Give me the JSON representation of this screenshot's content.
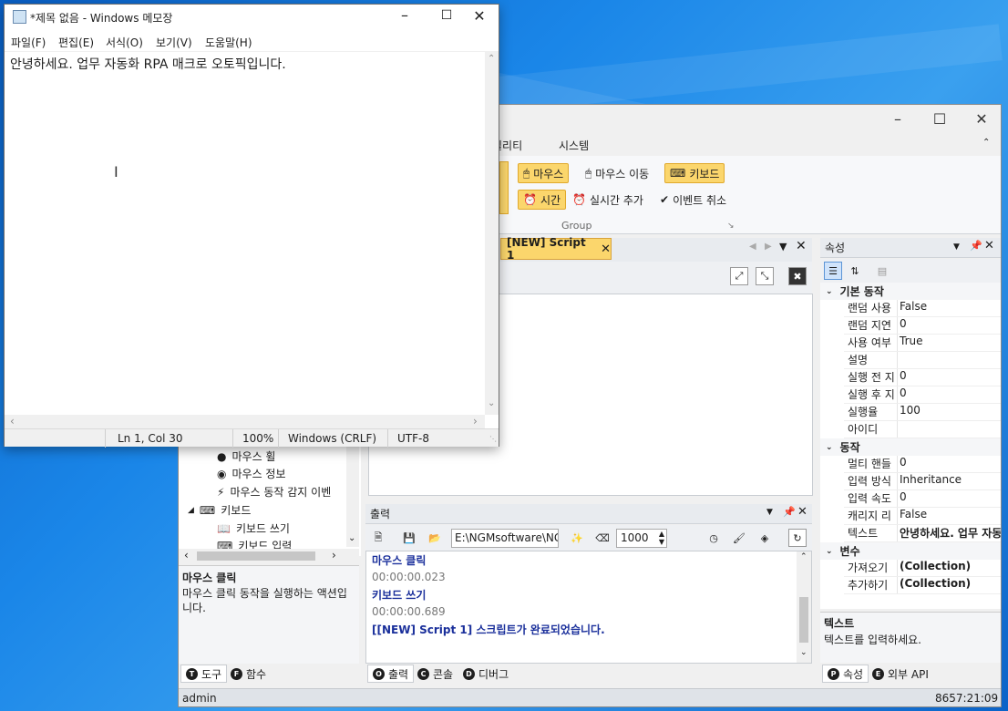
{
  "notepad": {
    "title": "*제목 없음 - Windows 메모장",
    "menu": [
      "파일(F)",
      "편집(E)",
      "서식(O)",
      "보기(V)",
      "도움말(H)"
    ],
    "content": "안녕하세요. 업무 자동화 RPA 매크로 오토픽입니다.",
    "status": {
      "position": "Ln 1, Col 30",
      "zoom": "100%",
      "line_ending": "Windows (CRLF)",
      "encoding": "UTF-8"
    }
  },
  "app": {
    "menu": [
      "틸리티",
      "시스템"
    ],
    "ribbon": {
      "mouse": "마우스",
      "mouse_move": "마우스 이동",
      "keyboard": "키보드",
      "time": "시간",
      "realtime_add": "실시간 추가",
      "event_cancel": "이벤트 취소",
      "group_label": "Group"
    },
    "doc_tab": "[NEW] Script 1",
    "tools_tree": [
      "마우스 휠",
      "마우스 정보",
      "마우스 동작 감지 이벤",
      "키보드",
      "키보드 쓰기",
      "키보드 입력"
    ],
    "tool_desc": {
      "title": "마우스 클릭",
      "text": "마우스 클릭 동작을 실행하는 액션입니다."
    },
    "left_tabs": [
      "도구",
      "함수"
    ],
    "output": {
      "title": "출력",
      "path": "E:\\NGMsoftware\\NG",
      "count": "1000",
      "lines": [
        {
          "text": "마우스 클릭",
          "style": "b"
        },
        {
          "text": "00:00:00.023",
          "style": "g"
        },
        {
          "text": "키보드 쓰기",
          "style": "b"
        },
        {
          "text": "00:00:00.689",
          "style": "g"
        },
        {
          "text": "[[NEW] Script 1] 스크립트가 완료되었습니다.",
          "style": "b"
        }
      ]
    },
    "output_tabs": [
      "출력",
      "콘솔",
      "디버그"
    ],
    "properties": {
      "title": "속성",
      "categories": [
        {
          "name": "기본 동작",
          "rows": [
            {
              "k": "랜덤 사용",
              "v": "False"
            },
            {
              "k": "랜덤 지연",
              "v": "0"
            },
            {
              "k": "사용 여부",
              "v": "True"
            },
            {
              "k": "설명",
              "v": ""
            },
            {
              "k": "실행 전 지",
              "v": "0"
            },
            {
              "k": "실행 후 지",
              "v": "0"
            },
            {
              "k": "실행율",
              "v": "100"
            },
            {
              "k": "아이디",
              "v": ""
            }
          ]
        },
        {
          "name": "동작",
          "rows": [
            {
              "k": "멀티 핸들",
              "v": "0"
            },
            {
              "k": "입력 방식",
              "v": "Inheritance"
            },
            {
              "k": "입력 속도",
              "v": "0"
            },
            {
              "k": "캐리지 리",
              "v": "False"
            },
            {
              "k": "텍스트",
              "v": "안녕하세요. 업무 자동"
            }
          ]
        },
        {
          "name": "변수",
          "rows": [
            {
              "k": "가져오기",
              "v": "(Collection)"
            },
            {
              "k": "추가하기",
              "v": "(Collection)"
            }
          ]
        }
      ],
      "desc_title": "텍스트",
      "desc_text": "텍스트를 입력하세요."
    },
    "prop_tabs": [
      "속성",
      "외부 API"
    ],
    "statusbar": {
      "user": "admin",
      "time": "8657:21:09"
    }
  }
}
